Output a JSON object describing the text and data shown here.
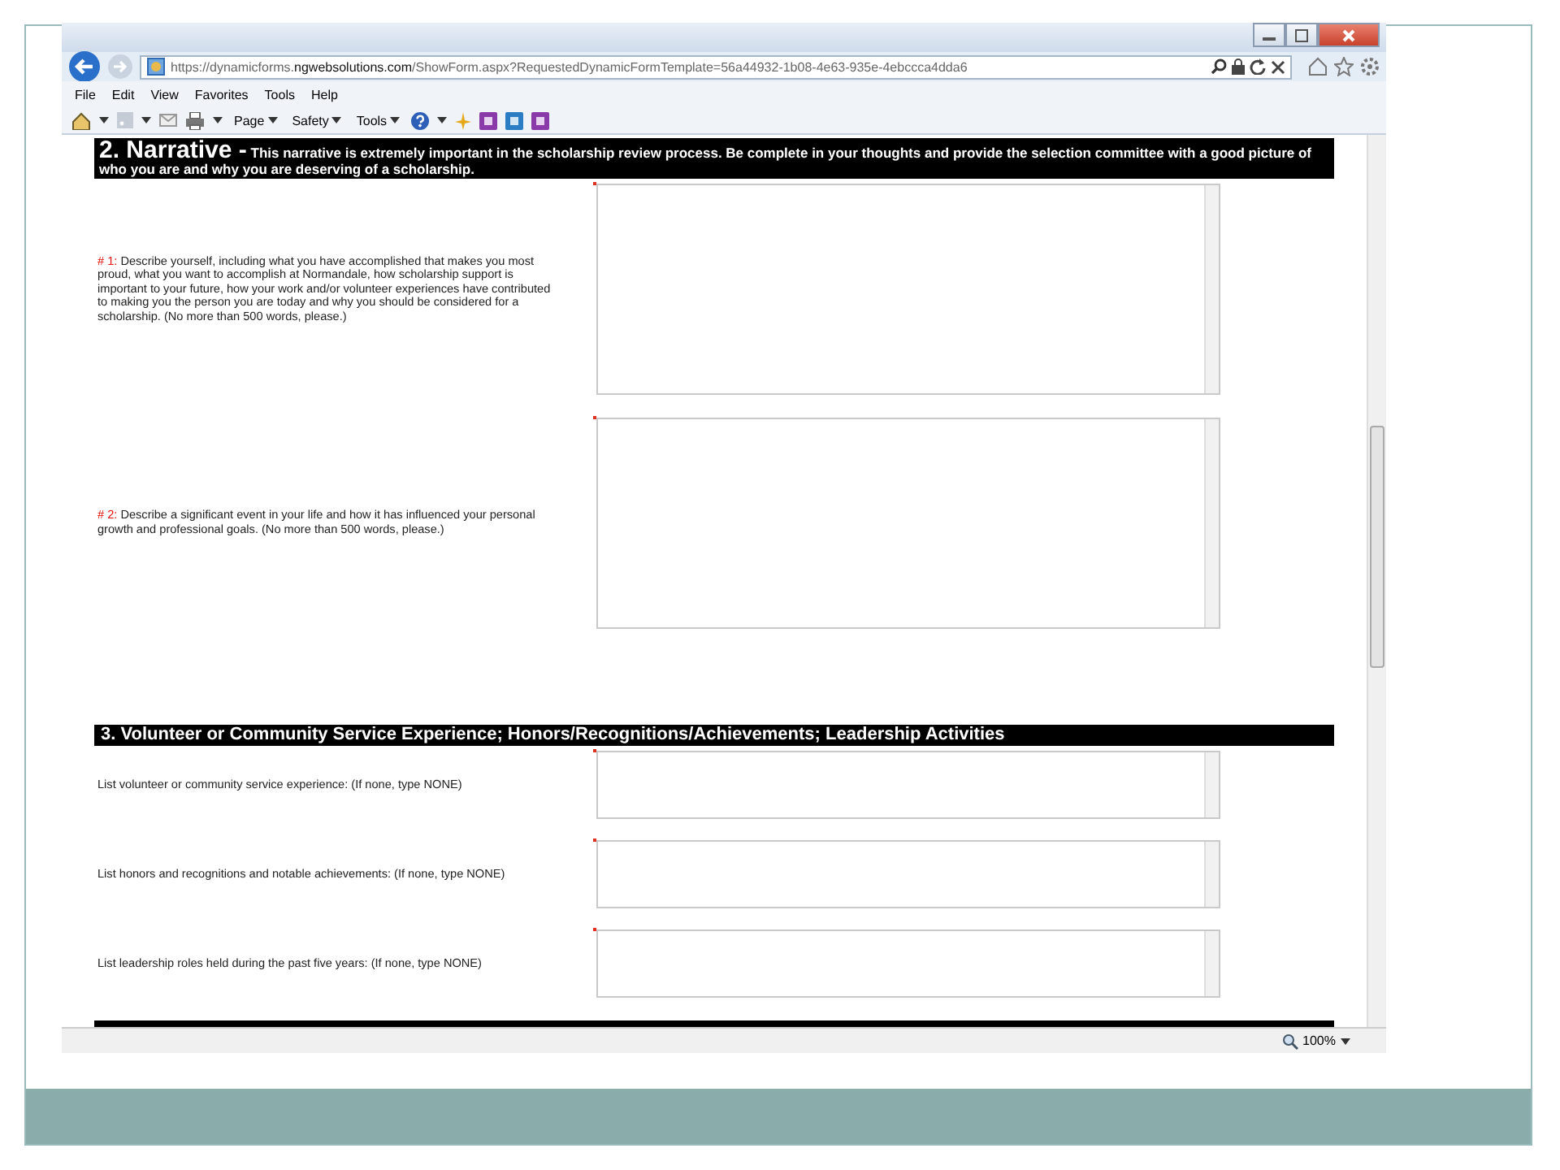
{
  "browser": {
    "url": "https://dynamicforms.**ngwebsolutions.com**/ShowForm.aspx?RequestedDynamicFormTemplate=56a44932-1b08-4e63-935e-4ebccca4dda6",
    "menu": [
      "File",
      "Edit",
      "View",
      "Favorites",
      "Tools",
      "Help"
    ],
    "command_bar": [
      "Page",
      "Safety",
      "Tools"
    ],
    "zoom": "100%"
  },
  "sections": [
    {
      "kind": "narrative",
      "title": "2.  Narrative -",
      "description": "This narrative is extremely important in the scholarship review process.  Be complete in your thoughts and provide the selection committee with a good picture of who you are and why you are deserving of a scholarship.",
      "questions": [
        {
          "number": "# 1:",
          "text": "Describe yourself, including what you have accomplished that makes you most proud, what you want to accomplish at Normandale, how scholarship support is important to your future, how your work and/or volunteer experiences have contributed to making you the person you are today and why you should be considered for a scholarship. (No more than 500 words, please.)",
          "required": true
        },
        {
          "number": "# 2:",
          "text": "Describe a significant event in your life and how it has influenced your personal growth and professional goals. (No more than 500 words, please.)",
          "required": true
        }
      ]
    },
    {
      "kind": "list",
      "title": "3.  Volunteer or Community Service Experience; Honors/Recognitions/Achievements; Leadership Activities",
      "questions": [
        {
          "text": "List volunteer or community service experience:  (If none, type NONE)",
          "required": true
        },
        {
          "text": "List honors and recognitions and notable achievements:  (If none, type NONE)",
          "required": true
        },
        {
          "text": "List leadership roles held during the past five years: (If none, type NONE)",
          "required": true
        }
      ]
    }
  ]
}
